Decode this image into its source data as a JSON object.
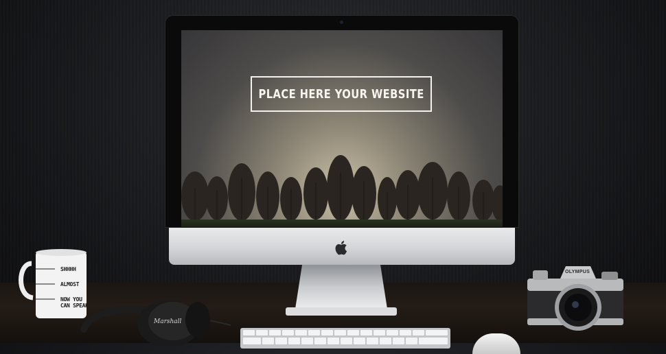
{
  "screen": {
    "headline": "PLACE HERE YOUR WEBSITE"
  },
  "mug": {
    "levels": [
      "SHHHH",
      "ALMOST",
      "NOW YOU",
      "CAN SPEAK"
    ]
  },
  "headphones": {
    "brand": "Marshall"
  },
  "camera": {
    "brand": "OLYMPUS"
  },
  "icons": [
    "apple-logo-icon"
  ],
  "colors": {
    "wall": "#16171a",
    "desk": "#241c16",
    "monitor_chin": "#d4d5d8",
    "screen_sky": "#8c8575"
  }
}
